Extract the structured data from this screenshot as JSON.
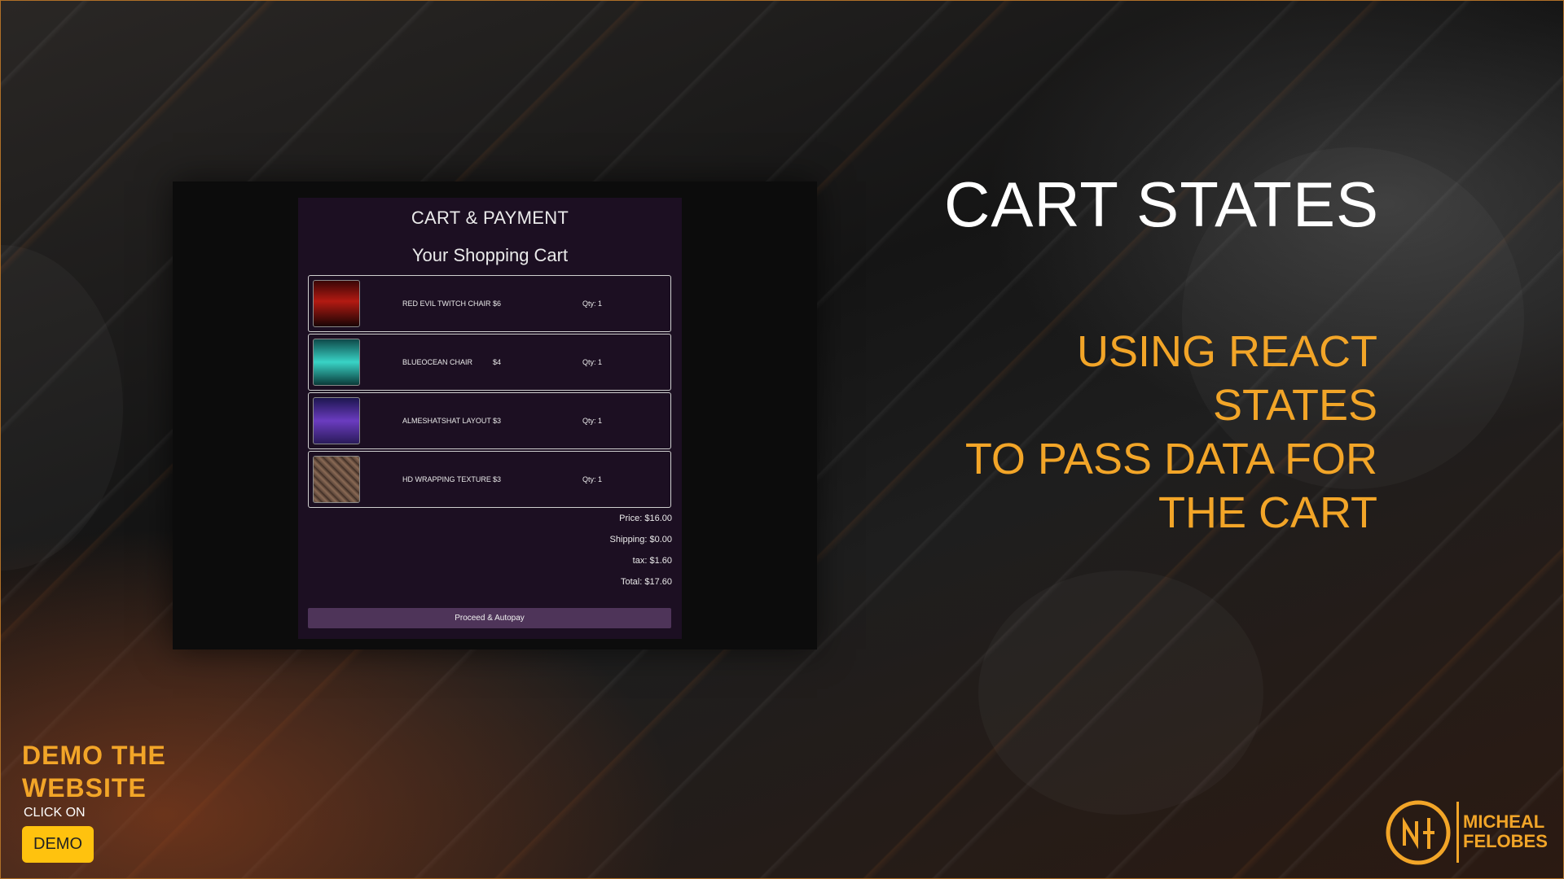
{
  "slide": {
    "title": "CART STATES",
    "subtitle_lines": [
      "USING REACT STATES",
      "TO PASS DATA FOR",
      "THE CART"
    ]
  },
  "cart": {
    "header": "CART & PAYMENT",
    "subheader": "Your Shopping Cart",
    "items": [
      {
        "name": "RED EVIL TWITCH CHAIR",
        "price": "$6",
        "qty": "Qty: 1"
      },
      {
        "name": "BLUEOCEAN CHAIR",
        "price": "$4",
        "qty": "Qty: 1"
      },
      {
        "name": "ALMESHATSHAT LAYOUT",
        "price": "$3",
        "qty": "Qty: 1"
      },
      {
        "name": "HD WRAPPING TEXTURE",
        "price": "$3",
        "qty": "Qty: 1"
      }
    ],
    "summary": {
      "price": "Price: $16.00",
      "shipping": "Shipping: $0.00",
      "tax": "tax: $1.60",
      "total": "Total: $17.60"
    },
    "proceed_label": "Proceed & Autopay"
  },
  "demo": {
    "heading_lines": [
      "DEMO THE",
      "WEBSITE"
    ],
    "click_on": "CLICK ON",
    "button_label": "DEMO"
  },
  "logo": {
    "name_lines": [
      "MICHEAL",
      "FELOBES"
    ],
    "icon": "nf-monogram-icon"
  },
  "colors": {
    "accent": "#f2a528",
    "demo_button": "#ffc20e",
    "cart_panel": "#1c0f22",
    "proceed_button": "#4e3459"
  }
}
